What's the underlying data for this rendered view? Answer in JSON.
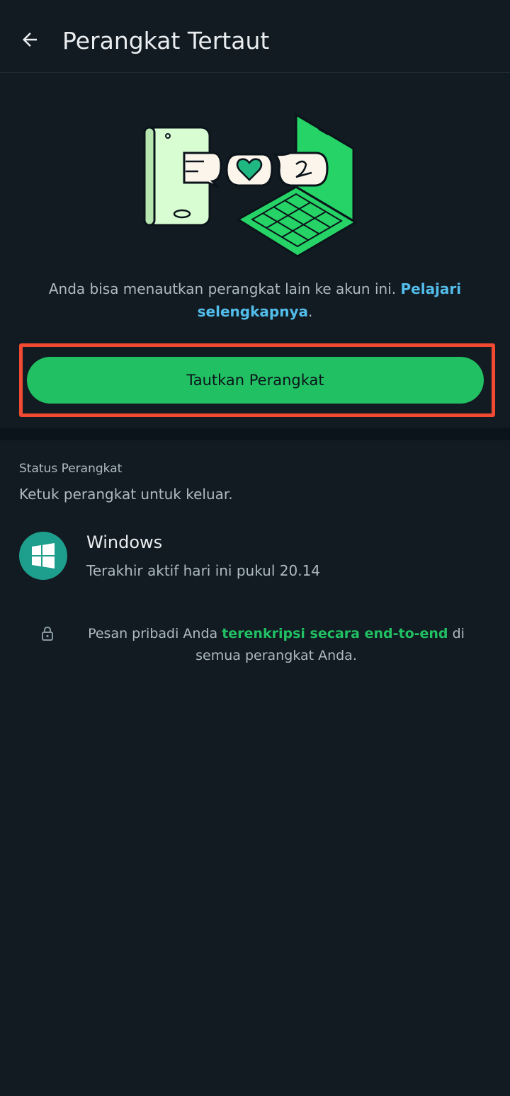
{
  "appbar": {
    "title": "Perangkat Tertaut"
  },
  "hero": {
    "description": "Anda bisa menautkan perangkat lain ke akun ini.",
    "learn_more": "Pelajari selengkapnya",
    "period": ".",
    "link_button_label": "Tautkan Perangkat"
  },
  "status": {
    "label": "Status Perangkat",
    "hint": "Ketuk perangkat untuk keluar.",
    "devices": [
      {
        "name": "Windows",
        "last_active": "Terakhir aktif hari ini pukul 20.14"
      }
    ]
  },
  "footer": {
    "note_before": "Pesan pribadi Anda",
    "note_highlight": "terenkripsi secara end-to-end",
    "note_after": "di semua perangkat Anda."
  },
  "colors": {
    "accent_green": "#21c063",
    "link_blue": "#53bdeb",
    "highlight_red": "#f04a32",
    "background": "#121b22"
  },
  "icons": {
    "back": "arrow-left-icon",
    "device": "windows-logo-icon",
    "lock": "lock-icon"
  }
}
